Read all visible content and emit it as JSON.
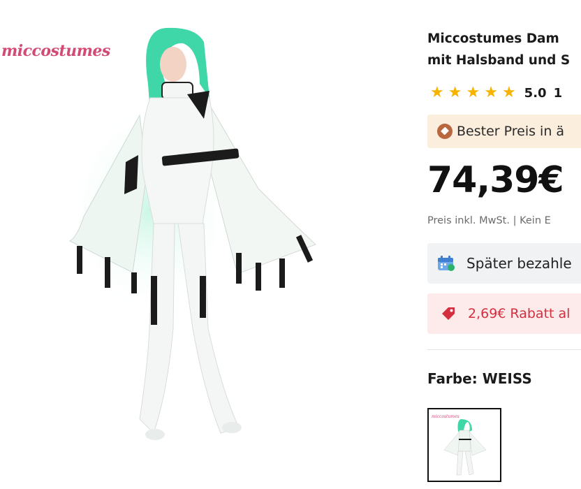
{
  "gallery": {
    "brand_logo": "miccostumes"
  },
  "product": {
    "title_line1": "Miccostumes Dam",
    "title_line2": "mit Halsband und S",
    "rating_value": "5.0",
    "rating_count": "1",
    "best_price_text": "Bester Preis in ä",
    "price": "74,39€",
    "price_note": "Preis inkl. MwSt. | Kein E",
    "pay_later_text": "Später bezahle",
    "discount_text": "2,69€ Rabatt al",
    "color_label": "Farbe: WEISS",
    "stars": 5
  },
  "colors": {
    "star": "#f6b400",
    "discount_red": "#d32f3f",
    "best_price_bg": "#fbeedd",
    "brand_pink": "#d24b74",
    "wig_green": "#3fd6a8"
  }
}
